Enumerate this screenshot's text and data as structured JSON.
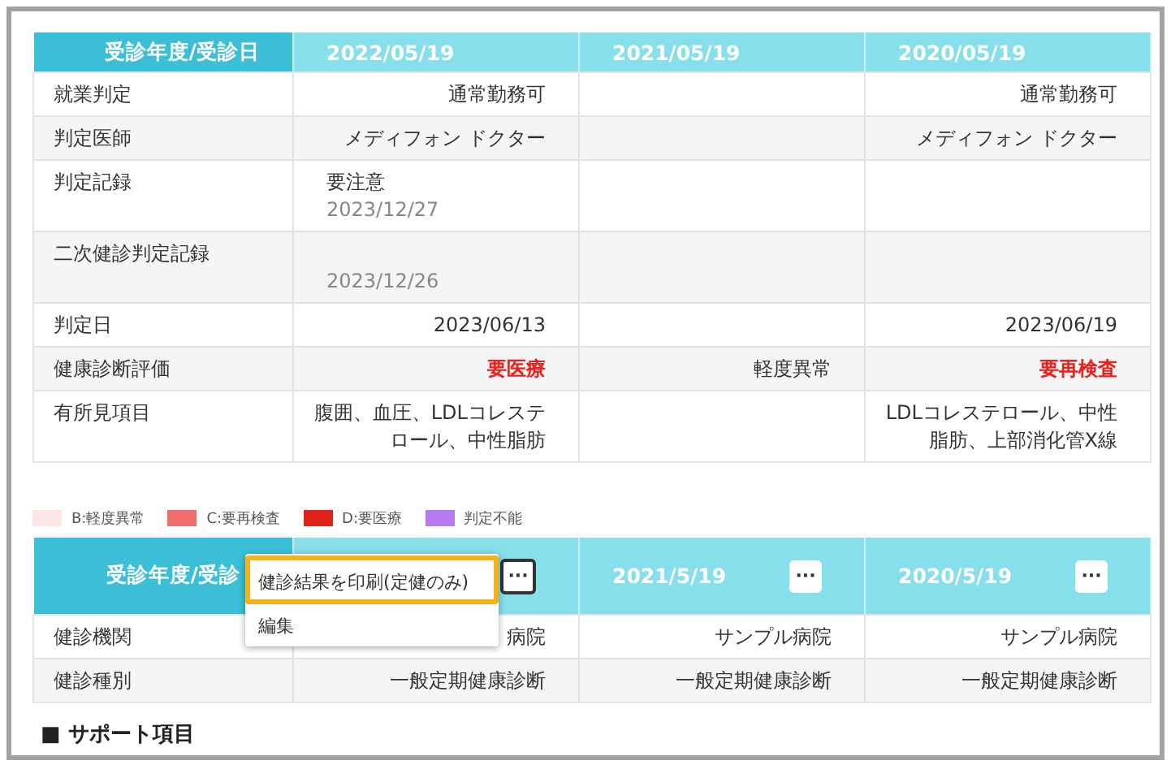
{
  "results_table": {
    "corner_label": "受診年度/受診日",
    "columns": [
      {
        "label": "2022/05/19"
      },
      {
        "label": "2021/05/19"
      },
      {
        "label": "2020/05/19"
      }
    ],
    "rows": [
      {
        "label": "就業判定",
        "cells": [
          {
            "text": "通常勤務可"
          },
          {},
          {
            "text": "通常勤務可"
          }
        ]
      },
      {
        "label": "判定医師",
        "cells": [
          {
            "text": "メディフォン ドクター"
          },
          {},
          {
            "text": "メディフォン ドクター"
          }
        ]
      },
      {
        "label": "判定記録",
        "cells": [
          {
            "kind": "record",
            "text": "要注意",
            "note": "2023/12/27"
          },
          {},
          {}
        ]
      },
      {
        "label": "二次健診判定記録",
        "cells": [
          {
            "kind": "record",
            "note": "2023/12/26"
          },
          {},
          {}
        ]
      },
      {
        "label": "判定日",
        "cells": [
          {
            "text": "2023/06/13"
          },
          {},
          {
            "text": "2023/06/19"
          }
        ]
      },
      {
        "label": "健康診断評価",
        "cells": [
          {
            "text": "要医療",
            "alert": true
          },
          {
            "text": "軽度異常",
            "alert": false
          },
          {
            "text": "要再検査",
            "alert": true
          }
        ]
      },
      {
        "label": "有所見項目",
        "cells": [
          {
            "text": "腹囲、血圧、LDLコレステロール、中性脂肪"
          },
          {},
          {
            "text": "LDLコレステロール、中性脂肪、上部消化管X線"
          }
        ]
      }
    ]
  },
  "legend": [
    {
      "label": "B:軽度異常",
      "color": "#fde6e6"
    },
    {
      "label": "C:要再検査",
      "color": "#f26d6d"
    },
    {
      "label": "D:要医療",
      "color": "#e0241c"
    },
    {
      "label": "判定不能",
      "color": "#b87af0"
    }
  ],
  "exams_table": {
    "corner_label": "受診年度/受診",
    "columns": [
      {
        "menu_button": "···",
        "focused": true
      },
      {
        "label": "2021/5/19",
        "menu_button": "···",
        "focused": false
      },
      {
        "label": "2020/5/19",
        "menu_button": "···",
        "focused": false
      }
    ],
    "rows": [
      {
        "label": "健診機関",
        "cells": [
          {
            "text": "病院"
          },
          {
            "text": "サンプル病院"
          },
          {
            "text": "サンプル病院"
          }
        ]
      },
      {
        "label": "健診種別",
        "cells": [
          {
            "text": "一般定期健康診断"
          },
          {
            "text": "一般定期健康診断"
          },
          {
            "text": "一般定期健康診断"
          }
        ]
      }
    ]
  },
  "context_menu": {
    "items": [
      {
        "label": "健診結果を印刷(定健のみ)",
        "selected": true
      },
      {
        "label": "編集",
        "selected": false
      }
    ]
  },
  "section_heading": "■ サポート項目"
}
